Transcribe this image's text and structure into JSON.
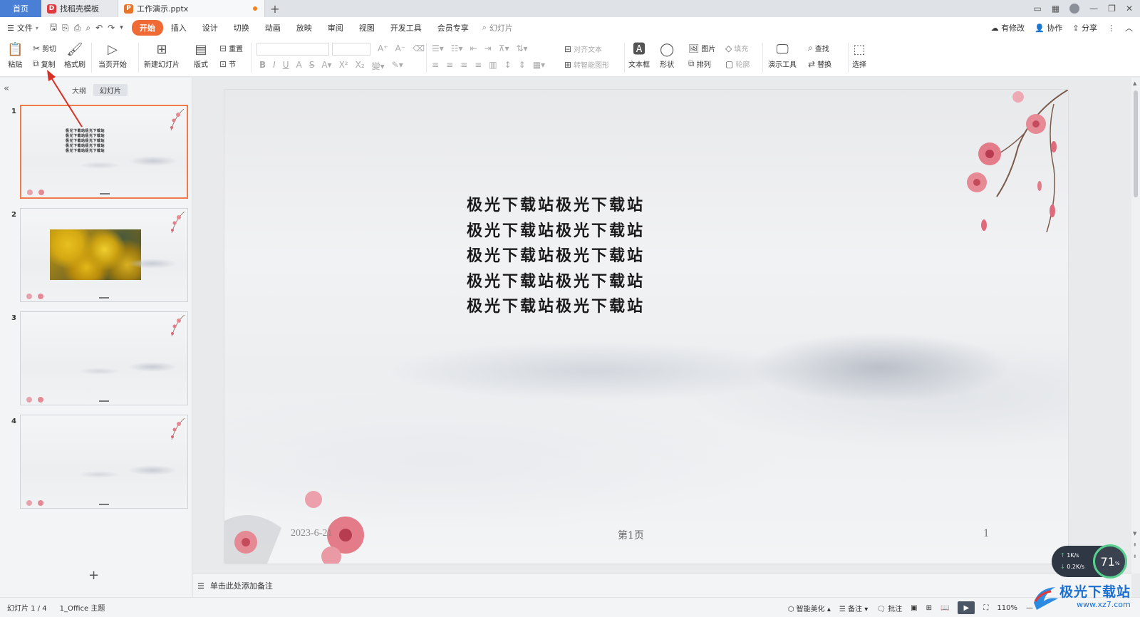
{
  "titlebar": {
    "home_tab": "首页",
    "tabs": [
      {
        "label": "找稻壳模板"
      },
      {
        "label": "工作演示.pptx"
      }
    ],
    "new_tab": "+"
  },
  "menubar": {
    "file_label": "文件",
    "tabs": [
      "开始",
      "插入",
      "设计",
      "切换",
      "动画",
      "放映",
      "审阅",
      "视图",
      "开发工具",
      "会员专享"
    ],
    "active_tab": "开始",
    "search_label": "幻灯片",
    "right": {
      "unsaved": "有修改",
      "collab": "协作",
      "share": "分享"
    }
  },
  "ribbon": {
    "paste": "粘贴",
    "cut": "剪切",
    "copy": "复制",
    "format_painter": "格式刷",
    "from_current": "当页开始",
    "new_slide": "新建幻灯片",
    "layout": "版式",
    "reset": "重置",
    "section": "节",
    "align_text": "对齐文本",
    "smart_graphic": "转智能图形",
    "textbox": "文本框",
    "shape": "形状",
    "picture": "图片",
    "fill": "填充",
    "arrange": "排列",
    "outline": "轮廓",
    "presentation_tools": "演示工具",
    "find": "查找",
    "replace": "替换",
    "select": "选择"
  },
  "leftpanel": {
    "tabs": [
      "大纲",
      "幻灯片"
    ],
    "active_tab": "幻灯片",
    "slides": [
      {
        "num": "1",
        "selected": true,
        "has_photo": false
      },
      {
        "num": "2",
        "selected": false,
        "has_photo": true
      },
      {
        "num": "3",
        "selected": false,
        "has_photo": false
      },
      {
        "num": "4",
        "selected": false,
        "has_photo": false
      }
    ],
    "add_slide": "+",
    "thumb1_lines": [
      "极光下载站极光下载站",
      "极光下载站极光下载站",
      "极光下载站极光下载站",
      "极光下载站极光下载站",
      "极光下载站极光下载站"
    ]
  },
  "slide": {
    "lines": [
      "极光下载站极光下载站",
      "极光下载站极光下载站",
      "极光下载站极光下载站",
      "极光下载站极光下载站",
      "极光下载站极光下载站"
    ],
    "date": "2023-6-21",
    "page_label": "第1页",
    "slide_number": "1"
  },
  "notes": {
    "placeholder": "单击此处添加备注"
  },
  "statusbar": {
    "slide_index": "幻灯片 1 / 4",
    "theme": "1_Office 主题",
    "smart_beautify": "智能美化",
    "notes": "备注",
    "comments": "批注",
    "zoom": "110%"
  },
  "netmon": {
    "upload": "1K/s",
    "download": "0.2K/s",
    "percent": "71",
    "unit": "%"
  },
  "watermark": {
    "text": "极光下载站",
    "url": "www.xz7.com"
  },
  "colors": {
    "accent": "#f06a35",
    "home_tab": "#4a7fd6",
    "selection": "#f07a4a",
    "arrow": "#d93025"
  }
}
